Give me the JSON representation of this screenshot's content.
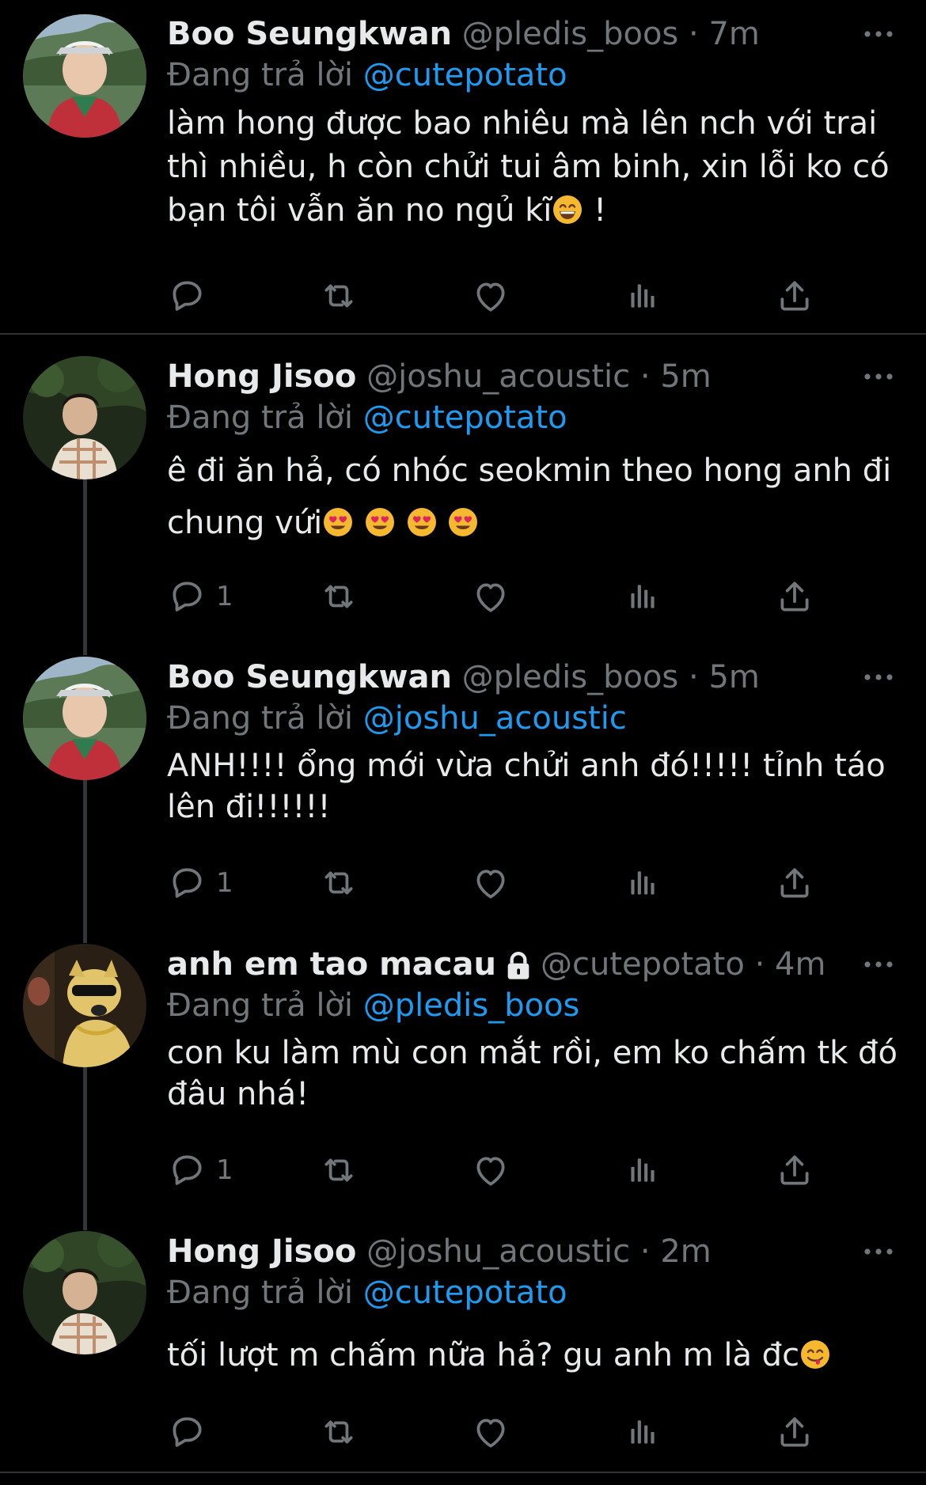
{
  "icons": {
    "reply": "reply-bubble-icon",
    "retweet": "retweet-icon",
    "like": "heart-icon",
    "analytics": "analytics-bars-icon",
    "share": "share-upload-icon",
    "more": "more-dots-icon",
    "lock": "lock-icon"
  },
  "colors": {
    "background": "#000000",
    "link": "#1d9bf0",
    "muted": "#71767b",
    "text": "#e7e9ea"
  },
  "tweets": [
    {
      "name": "Boo Seungkwan",
      "handle": "@pledis_boos",
      "separator": "·",
      "time": "7m",
      "reply_prefix": "Đang trả lời",
      "reply_to": "@cutepotato",
      "text": "làm hong được bao nhiêu mà lên nch với trai thì nhiều, h còn chửi tui âm binh, xin lỗi ko có bạn tôi vẫn ăn no ngủ kĩ",
      "text_suffix": " !",
      "emoji": [
        "grinning-face"
      ],
      "reply_count": ""
    },
    {
      "name": "Hong Jisoo",
      "handle": "@joshu_acoustic",
      "separator": "·",
      "time": "5m",
      "reply_prefix": "Đang trả lời",
      "reply_to": "@cutepotato",
      "text": "ê đi ăn hả, có nhóc seokmin theo hong anh đi chung vứi",
      "emoji": [
        "heart-eyes",
        "heart-eyes",
        "heart-eyes",
        "heart-eyes"
      ],
      "reply_count": "1"
    },
    {
      "name": "Boo Seungkwan",
      "handle": "@pledis_boos",
      "separator": "·",
      "time": "5m",
      "reply_prefix": "Đang trả lời",
      "reply_to": "@joshu_acoustic",
      "text": "ANH!!!! ổng mới vừa chửi anh đó!!!!! tỉnh táo lên đi!!!!!!",
      "reply_count": "1"
    },
    {
      "name": "anh em tao macau",
      "handle": "@cutepotato",
      "separator": "·",
      "time": "4m",
      "reply_prefix": "Đang trả lời",
      "reply_to": "@pledis_boos",
      "text": "con ku làm mù con mắt rồi, em ko chấm tk đó đâu nhá!",
      "reply_count": "1"
    },
    {
      "name": "Hong Jisoo",
      "handle": "@joshu_acoustic",
      "separator": "·",
      "time": "2m",
      "reply_prefix": "Đang trả lời",
      "reply_to": "@cutepotato",
      "text": "tối lượt m chấm nữa hả? gu anh m là đc",
      "emoji": [
        "yum-face"
      ],
      "reply_count": ""
    }
  ]
}
